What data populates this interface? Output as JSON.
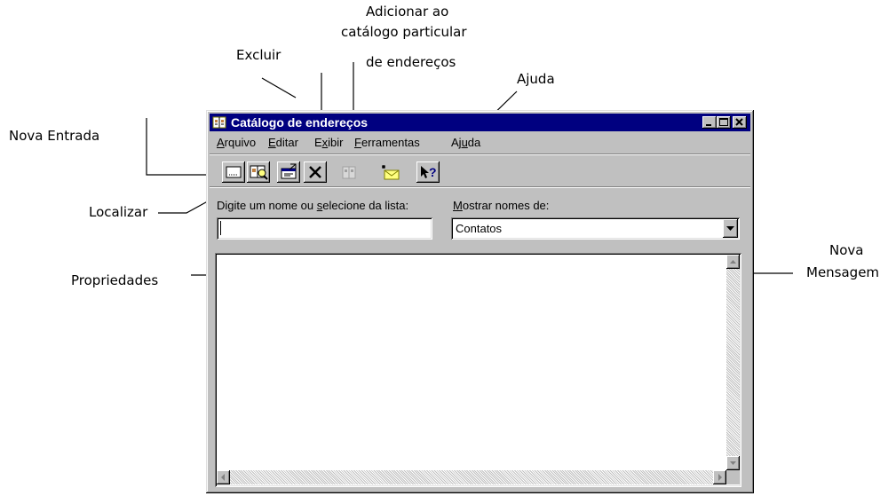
{
  "annotations": {
    "nova_entrada": "Nova Entrada",
    "localizar": "Localizar",
    "propriedades": "Propriedades",
    "excluir": "Excluir",
    "adicionar_line1": "Adicionar ao",
    "adicionar_line2": "catálogo particular",
    "adicionar_line3": "de endereços",
    "ajuda": "Ajuda",
    "nova_mensagem_line1": "Nova",
    "nova_mensagem_line2": "Mensagem"
  },
  "window": {
    "title": "Catálogo de endereços",
    "menu": [
      {
        "accel": "A",
        "rest": "rquivo"
      },
      {
        "accel": "E",
        "rest": "ditar"
      },
      {
        "pre": "E",
        "accel": "x",
        "rest": "ibir"
      },
      {
        "accel": "F",
        "rest": "erramentas"
      },
      {
        "pre": "Aj",
        "accel": "u",
        "rest": "da"
      }
    ],
    "toolbar": {
      "new_entry": "new-contact-icon",
      "find": "find-people-icon",
      "properties": "properties-icon",
      "delete": "delete-icon",
      "add_to_personal": "add-to-personal-book-icon",
      "new_message": "new-message-icon",
      "help": "whats-this-help-icon"
    },
    "search": {
      "label_pre": "Digite um nome ou ",
      "label_accel": "s",
      "label_rest": "elecione da lista:",
      "value": ""
    },
    "show_names": {
      "label_accel": "M",
      "label_rest": "ostrar nomes de:",
      "selected": "Contatos"
    }
  },
  "colors": {
    "titlebar": "#000080",
    "face": "#c0c0c0"
  }
}
